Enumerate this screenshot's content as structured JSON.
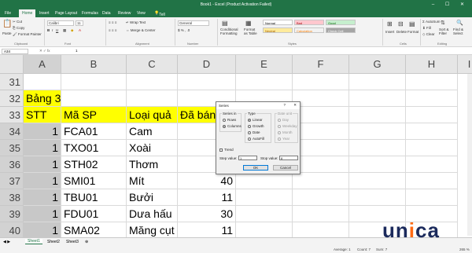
{
  "window": {
    "title": "Book1 - Excel (Product Activation Failed)",
    "controls": [
      "–",
      "☐",
      "✕"
    ]
  },
  "tabs": [
    "File",
    "Home",
    "Insert",
    "Page Layout",
    "Formulas",
    "Data",
    "Review",
    "View"
  ],
  "tell_me": "Tell me what you want to do...",
  "ribbon": {
    "clipboard": {
      "paste": "Paste",
      "cut": "Cut",
      "copy": "Copy",
      "format_painter": "Format Painter",
      "group": "Clipboard"
    },
    "font": {
      "name": "Calibri",
      "size": "11",
      "group": "Font"
    },
    "alignment": {
      "wrap": "Wrap Text",
      "merge": "Merge & Center",
      "group": "Alignment"
    },
    "number": {
      "format": "General",
      "group": "Number"
    },
    "styles": {
      "cond": "Conditional Formatting",
      "table": "Format as Table",
      "cells": [
        {
          "label": "Normal",
          "bg": "#ffffff",
          "fg": "#000000"
        },
        {
          "label": "Bad",
          "bg": "#ffc7ce",
          "fg": "#9c0006"
        },
        {
          "label": "Good",
          "bg": "#c6efce",
          "fg": "#006100"
        },
        {
          "label": "Neutral",
          "bg": "#ffeb9c",
          "fg": "#9c5700"
        },
        {
          "label": "Calculation",
          "bg": "#f2f2f2",
          "fg": "#fa7d00"
        },
        {
          "label": "Check Cell",
          "bg": "#a5a5a5",
          "fg": "#ffffff"
        }
      ],
      "group": "Styles"
    },
    "cells": {
      "insert": "Insert",
      "delete": "Delete",
      "format": "Format",
      "group": "Cells"
    },
    "editing": {
      "autosum": "AutoSum",
      "fill": "Fill",
      "clear": "Clear",
      "sort": "Sort & Filter",
      "find": "Find & Select",
      "group": "Editing"
    }
  },
  "formula_bar": {
    "name_box": "A34",
    "value": "1"
  },
  "columns": [
    "A",
    "B",
    "C",
    "D",
    "E",
    "F",
    "G",
    "H",
    "I"
  ],
  "rows": [
    {
      "num": "31",
      "A": "",
      "B": "",
      "C": "",
      "D": ""
    },
    {
      "num": "32",
      "A": "Bảng 3",
      "B": "",
      "C": "",
      "D": ""
    },
    {
      "num": "33",
      "A": "STT",
      "B": "Mã SP",
      "C": "Loại quả",
      "D": "Đã bán"
    },
    {
      "num": "34",
      "A": "1",
      "B": "FCA01",
      "C": "Cam",
      "D": ""
    },
    {
      "num": "35",
      "A": "1",
      "B": "TXO01",
      "C": "Xoài",
      "D": ""
    },
    {
      "num": "36",
      "A": "1",
      "B": "STH02",
      "C": "Thơm",
      "D": ""
    },
    {
      "num": "37",
      "A": "1",
      "B": "SMI01",
      "C": "Mít",
      "D": "40"
    },
    {
      "num": "38",
      "A": "1",
      "B": "TBU01",
      "C": "Bưởi",
      "D": "11"
    },
    {
      "num": "39",
      "A": "1",
      "B": "FDU01",
      "C": "Dưa hấu",
      "D": "30"
    },
    {
      "num": "40",
      "A": "1",
      "B": "SMA02",
      "C": "Măng cụt",
      "D": "11"
    }
  ],
  "dialog": {
    "title": "Series",
    "help": "?",
    "close": "✕",
    "series_in": {
      "label": "Series in",
      "rows": "Rows",
      "columns": "Columns",
      "selected": "Columns"
    },
    "type": {
      "label": "Type",
      "linear": "Linear",
      "growth": "Growth",
      "date": "Date",
      "autofill": "AutoFill",
      "selected": "Linear"
    },
    "date_unit": {
      "label": "Date unit",
      "day": "Day",
      "weekday": "Weekday",
      "month": "Month",
      "year": "Year"
    },
    "trend": "Trend",
    "step_label": "Step value:",
    "step_value": "1",
    "stop_label": "Stop value:",
    "stop_value": "8",
    "ok": "OK",
    "cancel": "Cancel"
  },
  "sheets": [
    "Sheet1",
    "Sheet2",
    "Sheet3"
  ],
  "active_sheet": "Sheet1",
  "status": {
    "average": "Average: 1",
    "count": "Count: 7",
    "sum": "Sum: 7",
    "zoom": "265 %"
  },
  "watermark": {
    "u": "un",
    "i": "i",
    "rest": "ca"
  }
}
